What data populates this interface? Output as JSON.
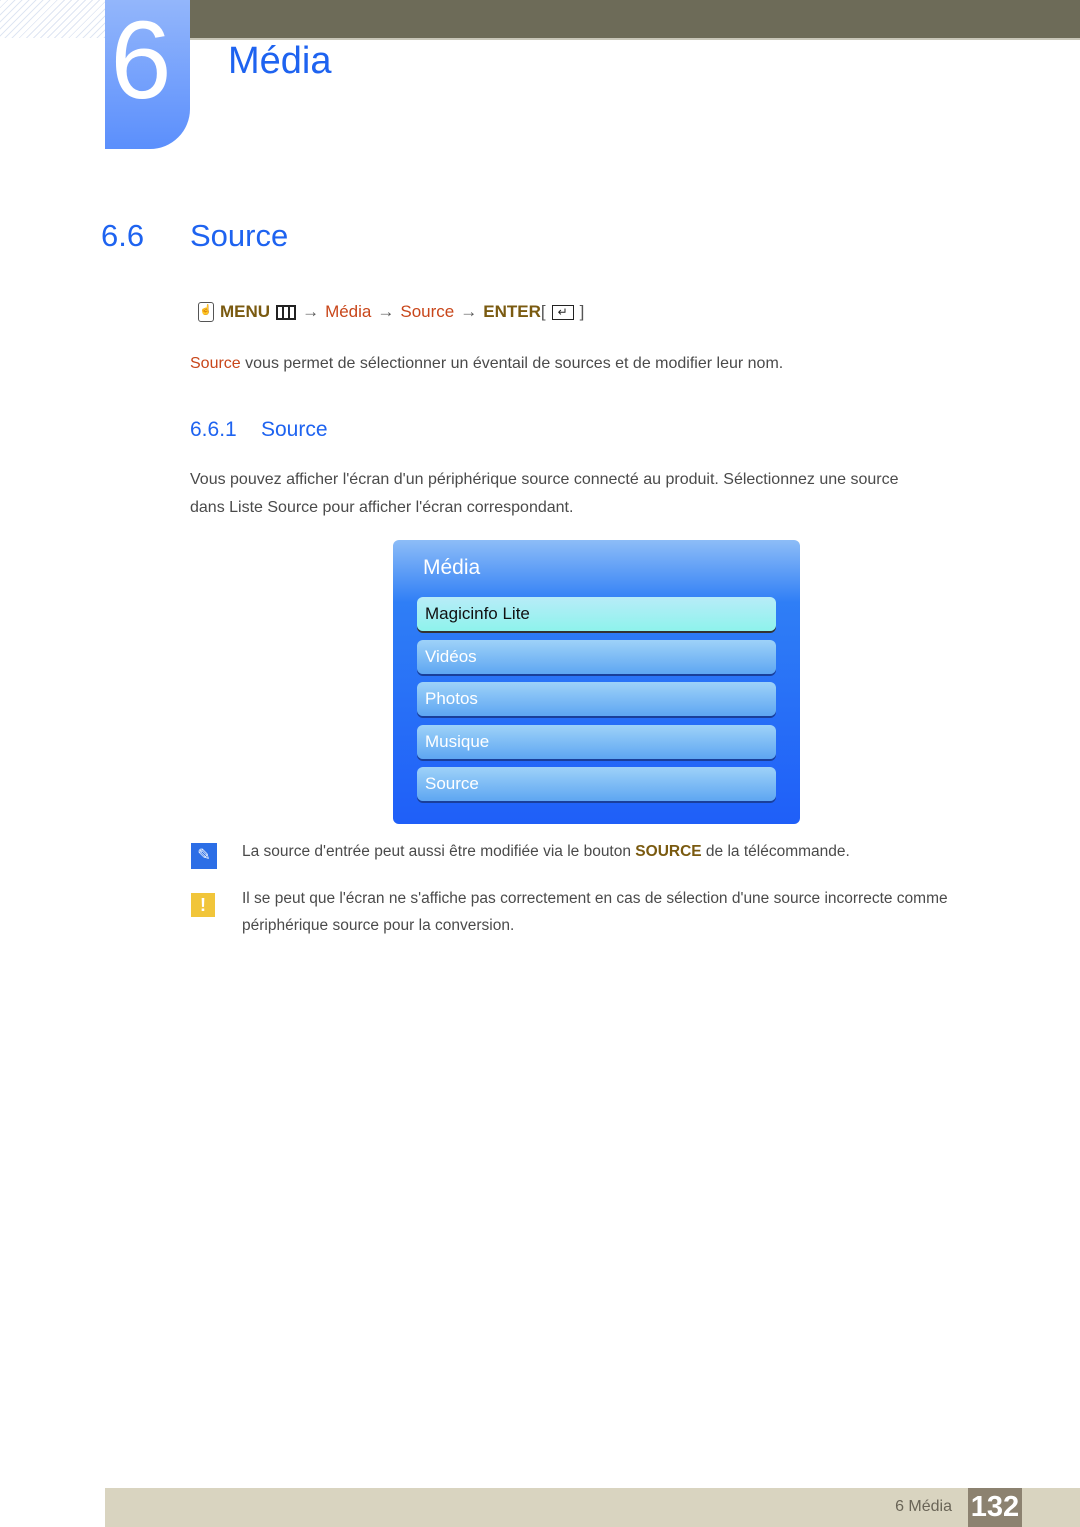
{
  "chapter": {
    "number": "6",
    "title": "Média"
  },
  "section": {
    "number": "6.6",
    "title": "Source"
  },
  "menu_path": {
    "menu_label": "MENU",
    "arrow": "→",
    "steps": [
      "Média",
      "Source"
    ],
    "enter_label": "ENTER",
    "open_bracket": "[",
    "close_bracket": "]",
    "enter_glyph": "↵",
    "remote_glyph": "☝"
  },
  "intro": {
    "highlight": "Source",
    "text": " vous permet de sélectionner un éventail de sources et de modifier leur nom."
  },
  "subsection": {
    "number": "6.6.1",
    "title": "Source"
  },
  "body": {
    "line1": "Vous pouvez afficher l'écran d'un périphérique source connecté au produit. Sélectionnez une source",
    "line2": "dans Liste Source pour afficher l'écran correspondant."
  },
  "osd_menu": {
    "title": "Média",
    "selected_index": 0,
    "items": [
      "Magicinfo Lite",
      "Vidéos",
      "Photos",
      "Musique",
      "Source"
    ]
  },
  "notes": {
    "info_glyph": "✎",
    "info_before": "La source d'entrée peut aussi être modifiée via le bouton ",
    "info_highlight": "SOURCE",
    "info_after": " de la télécommande.",
    "warn_glyph": "!",
    "warn_line1": "Il se peut que l'écran ne s'affiche pas correctement en cas de sélection d'une source incorrecte comme",
    "warn_line2": "périphérique source pour la conversion."
  },
  "footer": {
    "label": "6 Média",
    "page": "132"
  },
  "colors": {
    "heading_blue": "#1e63f0",
    "accent_red": "#c8461a",
    "accent_gold": "#7a5a10",
    "footer_bg": "#d9d4c0",
    "page_box": "#8c8270"
  }
}
